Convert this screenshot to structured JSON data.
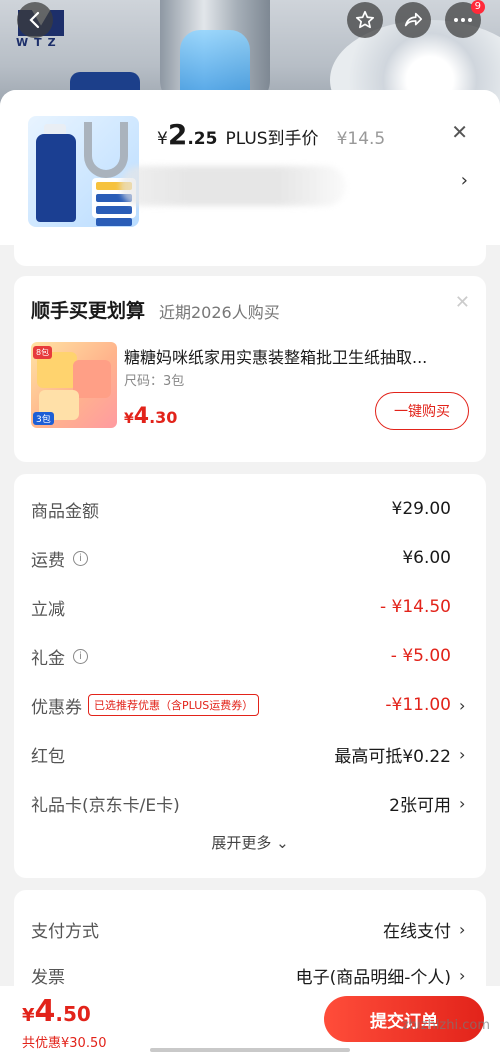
{
  "top_bar": {
    "logo_text": "WTZ",
    "more_badge": "9",
    "icons": [
      "back-arrow-icon",
      "star-icon",
      "share-icon",
      "more-dots-icon"
    ]
  },
  "product": {
    "yen": "¥",
    "price_int": "2",
    "price_dec": ".25",
    "plus_label": "PLUS到手价",
    "original_price": "¥14.5"
  },
  "bundle": {
    "title": "顺手买更划算",
    "subtitle": "近期2026人购买",
    "item_name": "糖糖妈咪纸家用实惠装整箱批卫生纸抽取...",
    "item_spec": "尺码：3包",
    "price_yen": "¥",
    "price_int": "4",
    "price_dec": ".30",
    "buy_label": "一键购买",
    "thumb_badge": "8包",
    "thumb_num": "3包"
  },
  "fees": {
    "rows": [
      {
        "label": "商品金额",
        "value": "¥29.00"
      },
      {
        "label": "运费",
        "value": "¥6.00"
      },
      {
        "label": "立减",
        "value": "- ¥14.50"
      },
      {
        "label": "礼金",
        "value": "- ¥5.00"
      },
      {
        "label": "优惠券",
        "tag": "已选推荐优惠（含PLUS运费券）",
        "value": "-¥11.00"
      },
      {
        "label": "红包",
        "value": "最高可抵¥0.22"
      },
      {
        "label": "礼品卡(京东卡/E卡)",
        "value": "2张可用"
      }
    ],
    "expand_more": "展开更多"
  },
  "payment": {
    "method_label": "支付方式",
    "method_value": "在线支付",
    "invoice_label": "发票",
    "invoice_value": "电子(商品明细-个人)"
  },
  "bottom": {
    "total_yen": "¥",
    "total_int": "4",
    "total_dec": ".50",
    "saved": "共优惠¥30.50",
    "submit_label": "提交订单",
    "watermark": "zhizhizhi.com"
  },
  "colors": {
    "accent_red": "#e2231a"
  }
}
